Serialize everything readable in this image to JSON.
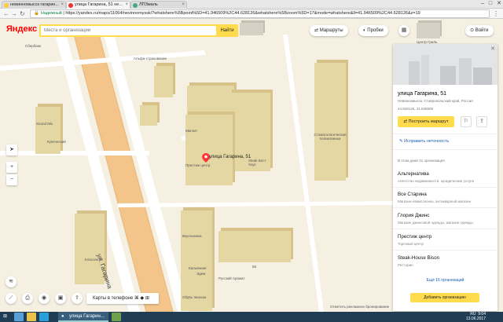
{
  "browser": {
    "tabs": [
      {
        "label": "невинномысск гагарин..."
      },
      {
        "label": "улица Гагарина, 51 не..."
      },
      {
        "label": "ЛПЗмаль"
      }
    ],
    "secure_label": "Надежный",
    "url": "https://yandex.ru/maps/11064/nevinnomyssk/?whatshere%5Bpoint%5D=41.946509%2C44.628126&whatshere%5Bzoom%5D=17&mode=whatshere&ll=41.946509%2C44.628126&z=19"
  },
  "header": {
    "logo": "Яндекс",
    "search_placeholder": "Места и организации",
    "find_button": "Найти",
    "routes_button": "Маршруты",
    "traffic_button": "Пробки",
    "login_button": "Войти"
  },
  "map": {
    "pin_label": "улица Гагарина, 51",
    "street_label": "ул. Гагарина",
    "phone_bar": "Карты в телефоне",
    "footnote": "Отметить рекламное бронирование",
    "scale": "20 м",
    "labels": [
      "Сбербанк",
      "Sound Mix",
      "Купеческий",
      "Альфа-страхование",
      "Магнит",
      "Престиж центр",
      "Steak Вест Хаус",
      "Стоматологическая поликлиника",
      "Вкусноежка",
      "Классик 60",
      "Кальянная",
      "Эдем",
      "Русский Аромат",
      "Обувь Эконом",
      "Центр Гриль",
      "Единый бытов"
    ],
    "bldg_numbers": [
      "55",
      "51"
    ]
  },
  "panel": {
    "title": "улица Гагарина, 51",
    "address": "Невинномысск, Ставропольский край, Россия",
    "coords": "44.628126, 41.946509",
    "route_button": "Построить маршрут",
    "edit_link": "Исправить неточность",
    "list_header": "В этом доме 21 организация",
    "orgs": [
      {
        "name": "Альтернатива",
        "desc": "Агентство недвижимости, юридические услуги"
      },
      {
        "name": "Все Старина",
        "desc": "Магазин-комиссионка, антикварный магазин"
      },
      {
        "name": "Глория Джинс",
        "desc": "Магазин джинсовой одежды, магазин одежды"
      },
      {
        "name": "Престиж центр",
        "desc": "Торговый центр"
      },
      {
        "name": "Steak-House Bison",
        "desc": "Ресторан"
      }
    ],
    "more_link": "Ещё 16 организаций",
    "add_org_button": "Добавить организацию"
  },
  "taskbar": {
    "chrome_item": "улица Гагарин...",
    "lang": "RU",
    "time": "9:04",
    "date": "13.06.2017"
  }
}
